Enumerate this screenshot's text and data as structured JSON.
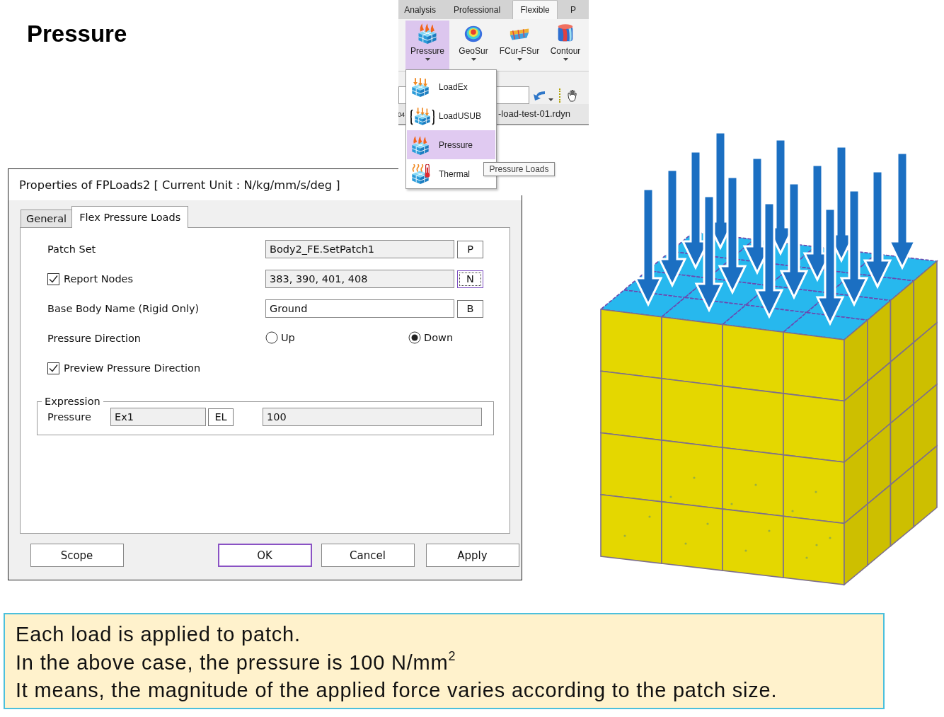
{
  "title": "Pressure",
  "ribbon": {
    "tabs": [
      {
        "label": "Analysis",
        "selected": false
      },
      {
        "label": "Professional",
        "selected": false
      },
      {
        "label": "Flexible",
        "selected": true
      },
      {
        "label": "P",
        "selected": false
      }
    ],
    "tools": [
      {
        "label": "Pressure",
        "kind": "pressure",
        "selected": true
      },
      {
        "label": "GeoSur",
        "kind": "geosur",
        "selected": false
      },
      {
        "label": "FCur-FSur",
        "kind": "fcur",
        "selected": false
      },
      {
        "label": "Contour",
        "kind": "contour",
        "selected": false
      }
    ],
    "document_tabs": [
      {
        "label": "04"
      },
      {
        "label": "-load-test-01.rdyn"
      }
    ]
  },
  "menu": {
    "items": [
      {
        "label": "LoadEx",
        "kind": "loadex",
        "selected": false
      },
      {
        "label": "LoadUSUB",
        "kind": "loadusub",
        "selected": false
      },
      {
        "label": "Pressure",
        "kind": "pressure",
        "selected": true
      },
      {
        "label": "Thermal",
        "kind": "thermal",
        "selected": false
      }
    ]
  },
  "tooltip": "Pressure Loads",
  "dialog": {
    "title": "Properties of FPLoads2 [ Current Unit : N/kg/mm/s/deg ]",
    "tabs": [
      {
        "label": "General",
        "selected": false
      },
      {
        "label": "Flex Pressure Loads",
        "selected": true
      }
    ],
    "rows": [
      {
        "kind": "field",
        "label": "Patch Set",
        "value": "Body2_FE.SetPatch1",
        "readonly": true,
        "button": "P",
        "focused": false
      },
      {
        "kind": "check-field",
        "label": "Report Nodes",
        "checked": true,
        "value": "383, 390, 401, 408",
        "readonly": true,
        "button": "N",
        "focused": true
      },
      {
        "kind": "field",
        "label": "Base Body Name (Rigid Only)",
        "value": "Ground",
        "readonly": false,
        "button": "B",
        "focused": false
      },
      {
        "kind": "radio",
        "label": "Pressure Direction",
        "options": [
          {
            "label": "Up",
            "selected": false
          },
          {
            "label": "Down",
            "selected": true
          }
        ]
      },
      {
        "kind": "check",
        "label": "Preview Pressure Direction",
        "checked": true
      }
    ],
    "expression": {
      "legend": "Expression",
      "label": "Pressure",
      "name": "Ex1",
      "button": "EL",
      "value": "100"
    },
    "buttons": [
      {
        "label": "Scope",
        "default": false
      },
      {
        "label": "OK",
        "default": true
      },
      {
        "label": "Cancel",
        "default": false
      },
      {
        "label": "Apply",
        "default": false
      }
    ]
  },
  "note": {
    "lines": [
      "Each load is applied to patch.",
      "In the above case, the pressure is 100 N/mm$^{2}$",
      "It means, the magnitude of the applied force varies according to the patch size."
    ]
  }
}
